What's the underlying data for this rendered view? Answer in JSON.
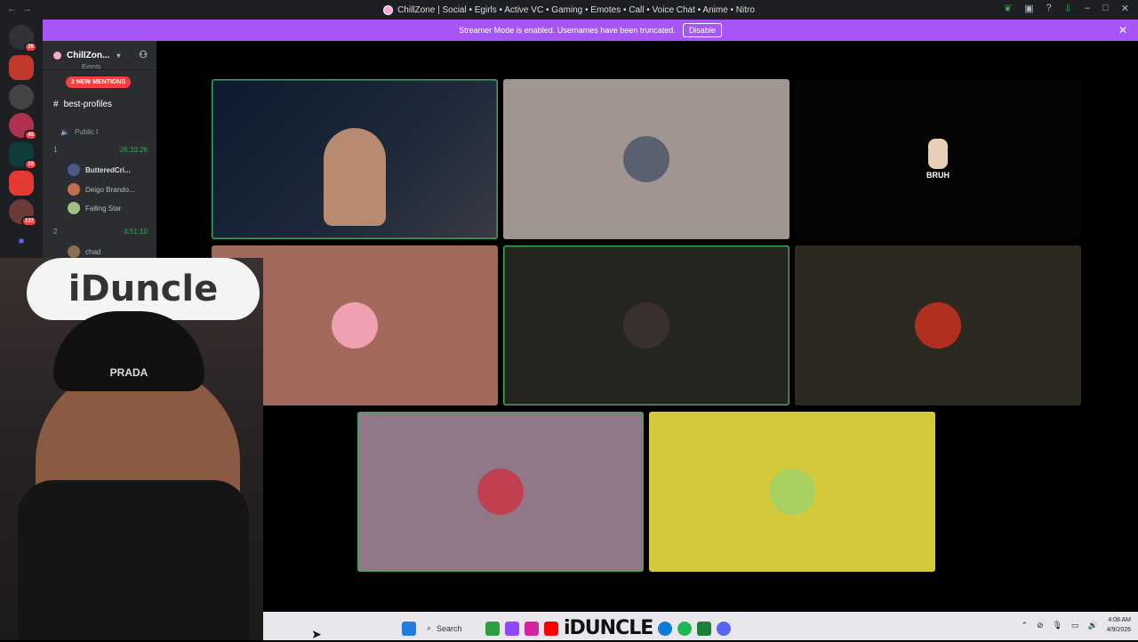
{
  "window": {
    "title": "ChillZone | Social • Egirls • Active VC • Gaming • Emotes • Call • Voice Chat • Anime • Nitro",
    "nav_icons": [
      "back-icon",
      "forward-icon"
    ]
  },
  "rail": {
    "dm_badge": "26",
    "servers": [
      {
        "badge": ""
      },
      {
        "badge": ""
      },
      {
        "badge": "45"
      },
      {
        "badge": "18"
      },
      {
        "badge": ""
      },
      {
        "badge": "137"
      }
    ]
  },
  "banner": {
    "text": "Streamer Mode is enabled. Usernames have been truncated.",
    "button": "Disable"
  },
  "sidebar": {
    "guild_name": "ChillZon...",
    "events": "Events",
    "mentions": "2 NEW MENTIONS",
    "channel_text": "best-profiles",
    "category": "Public I",
    "vc1": {
      "name": "1",
      "timer": "26:10:26"
    },
    "users": [
      "ButteredCri...",
      "Deigo Brando...",
      "Falling Star"
    ],
    "vc2": {
      "name": "2",
      "timer": "4:51:10"
    },
    "user2": "chad"
  },
  "tiles": [
    {
      "type": "video",
      "speaking": true
    },
    {
      "type": "avatar",
      "speaking": false
    },
    {
      "type": "avatar",
      "label": "BRUH",
      "speaking": false
    },
    {
      "type": "avatar",
      "speaking": false
    },
    {
      "type": "avatar",
      "speaking": true
    },
    {
      "type": "avatar",
      "speaking": false
    },
    {
      "type": "avatar",
      "speaking": true
    },
    {
      "type": "avatar",
      "speaking": false
    }
  ],
  "overlay": {
    "cap_text": "iDuncle",
    "hat_text": "PRADA"
  },
  "taskbar": {
    "search": "Search",
    "logo": "iDUNCLE",
    "time": "4:08 AM",
    "date": "4/9/2026"
  },
  "colors": {
    "accent_purple": "#a855f7",
    "speaking_green": "#3ba55d",
    "mention_red": "#f23f43"
  }
}
